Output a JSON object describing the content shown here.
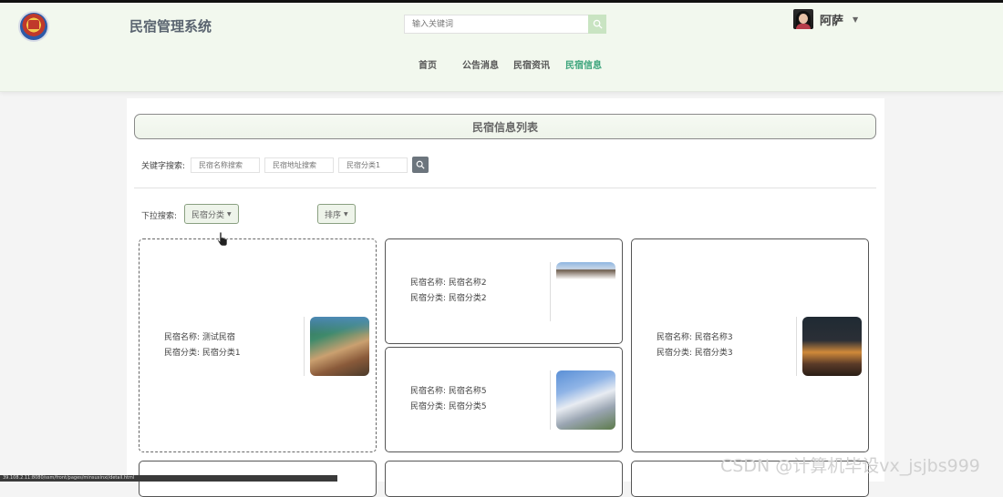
{
  "header": {
    "site_title": "民宿管理系统",
    "search_placeholder": "输入关键词",
    "username": "阿萨"
  },
  "nav": [
    {
      "label": "首页",
      "active": false
    },
    {
      "label": "公告消息",
      "active": false
    },
    {
      "label": "民宿资讯",
      "active": false
    },
    {
      "label": "民宿信息",
      "active": true
    }
  ],
  "list": {
    "title": "民宿信息列表",
    "keyword_label": "关键字搜索:",
    "keyword_inputs": [
      {
        "placeholder": "民宿名称搜索",
        "value": ""
      },
      {
        "placeholder": "民宿地址搜索",
        "value": ""
      },
      {
        "placeholder": "民宿分类1",
        "value": ""
      }
    ],
    "dropdown_label": "下拉搜索:",
    "category_dropdown": "民宿分类",
    "sort_dropdown": "排序"
  },
  "cards": [
    {
      "name_label": "民宿名称:",
      "name": "测试民宿",
      "category_label": "民宿分类:",
      "category": "民宿分类1"
    },
    {
      "name_label": "民宿名称:",
      "name": "民宿名称2",
      "category_label": "民宿分类:",
      "category": "民宿分类2"
    },
    {
      "name_label": "民宿名称:",
      "name": "民宿名称3",
      "category_label": "民宿分类:",
      "category": "民宿分类3"
    },
    {
      "name_label": "民宿名称:",
      "name": "民宿名称5",
      "category_label": "民宿分类:",
      "category": "民宿分类5"
    }
  ],
  "status_url": "39.108.2.11:8080/ssm/front/pages/minsuxinxi/detail.html",
  "watermark": "CSDN @计算机毕设vx_jsjbs999",
  "colors": {
    "accent": "#3aa37a",
    "header_bg": "#f2f8ee",
    "search_button": "#c9e4c2"
  }
}
